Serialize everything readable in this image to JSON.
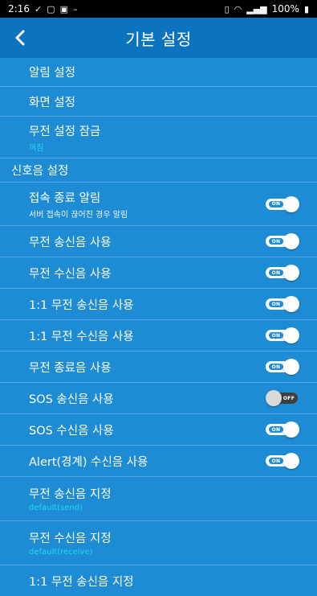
{
  "status_bar": {
    "time": "2:16",
    "battery": "100%"
  },
  "header": {
    "title": "기본 설정"
  },
  "items_top": [
    {
      "label": "알림 설정"
    },
    {
      "label": "화면 설정"
    },
    {
      "label": "무전 설정 잠금",
      "sub": "꺼짐"
    }
  ],
  "section_signal": "신호음 설정",
  "toggles": [
    {
      "label": "접속 종료 알림",
      "sub": "서버 접속이 끊어진 경우 알림",
      "state": "ON"
    },
    {
      "label": "무전 송신음 사용",
      "state": "ON"
    },
    {
      "label": "무전 수신음 사용",
      "state": "ON"
    },
    {
      "label": "1:1 무전 송신음 사용",
      "state": "ON"
    },
    {
      "label": "1:1 무전 수신음 사용",
      "state": "ON"
    },
    {
      "label": "무전 종료음 사용",
      "state": "ON"
    },
    {
      "label": "SOS 송신음 사용",
      "state": "OFF"
    },
    {
      "label": "SOS 수신음 사용",
      "state": "ON"
    },
    {
      "label": "Alert(경계) 수신음 사용",
      "state": "ON"
    }
  ],
  "items_bottom": [
    {
      "label": "무전 송신음 지정",
      "sub": "default(send)"
    },
    {
      "label": "무전 수신음 지정",
      "sub": "default(receive)"
    },
    {
      "label": "1:1 무전 송신음 지정"
    }
  ],
  "colors": {
    "background": "#1E8CD4",
    "appbar": "#0C73BE",
    "accent_text": "#1FE0F0"
  }
}
